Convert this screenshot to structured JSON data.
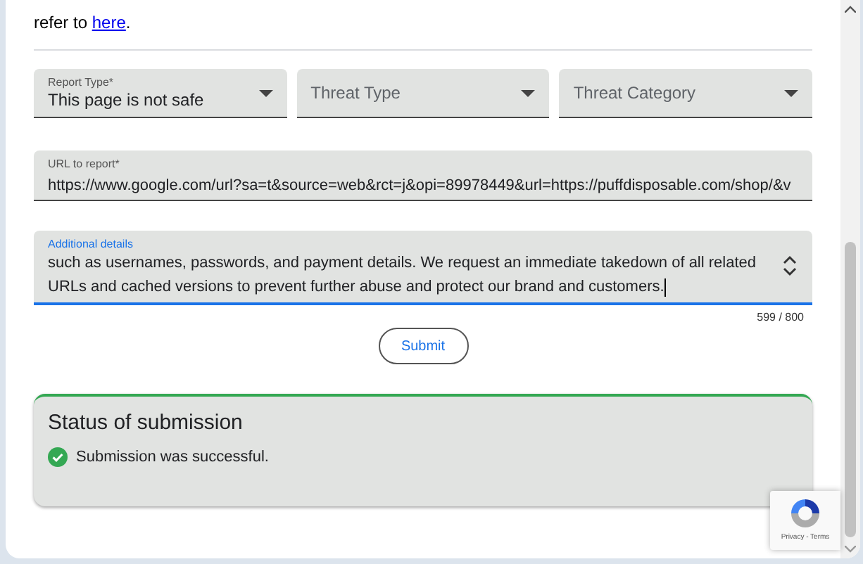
{
  "intro": {
    "before": "refer to ",
    "link": "here",
    "after": "."
  },
  "selects": [
    {
      "label": "Report Type*",
      "value": "This page is not safe"
    },
    {
      "placeholder": "Threat Type"
    },
    {
      "placeholder": "Threat Category"
    }
  ],
  "url_field": {
    "label": "URL to report*",
    "value": "https://www.google.com/url?sa=t&source=web&rct=j&opi=89978449&url=https://puffdisposable.com/shop/&v"
  },
  "details_field": {
    "label": "Additional details",
    "focused": true,
    "value": "such as usernames, passwords, and payment details. We request an immediate takedown of all related URLs and cached versions to prevent further abuse and protect our brand and customers.",
    "count": "599 / 800"
  },
  "submit_button": "Submit",
  "status": {
    "title": "Status of submission",
    "message": "Submission was successful.",
    "success": true
  },
  "recaptcha": {
    "links": "Privacy - Terms"
  }
}
